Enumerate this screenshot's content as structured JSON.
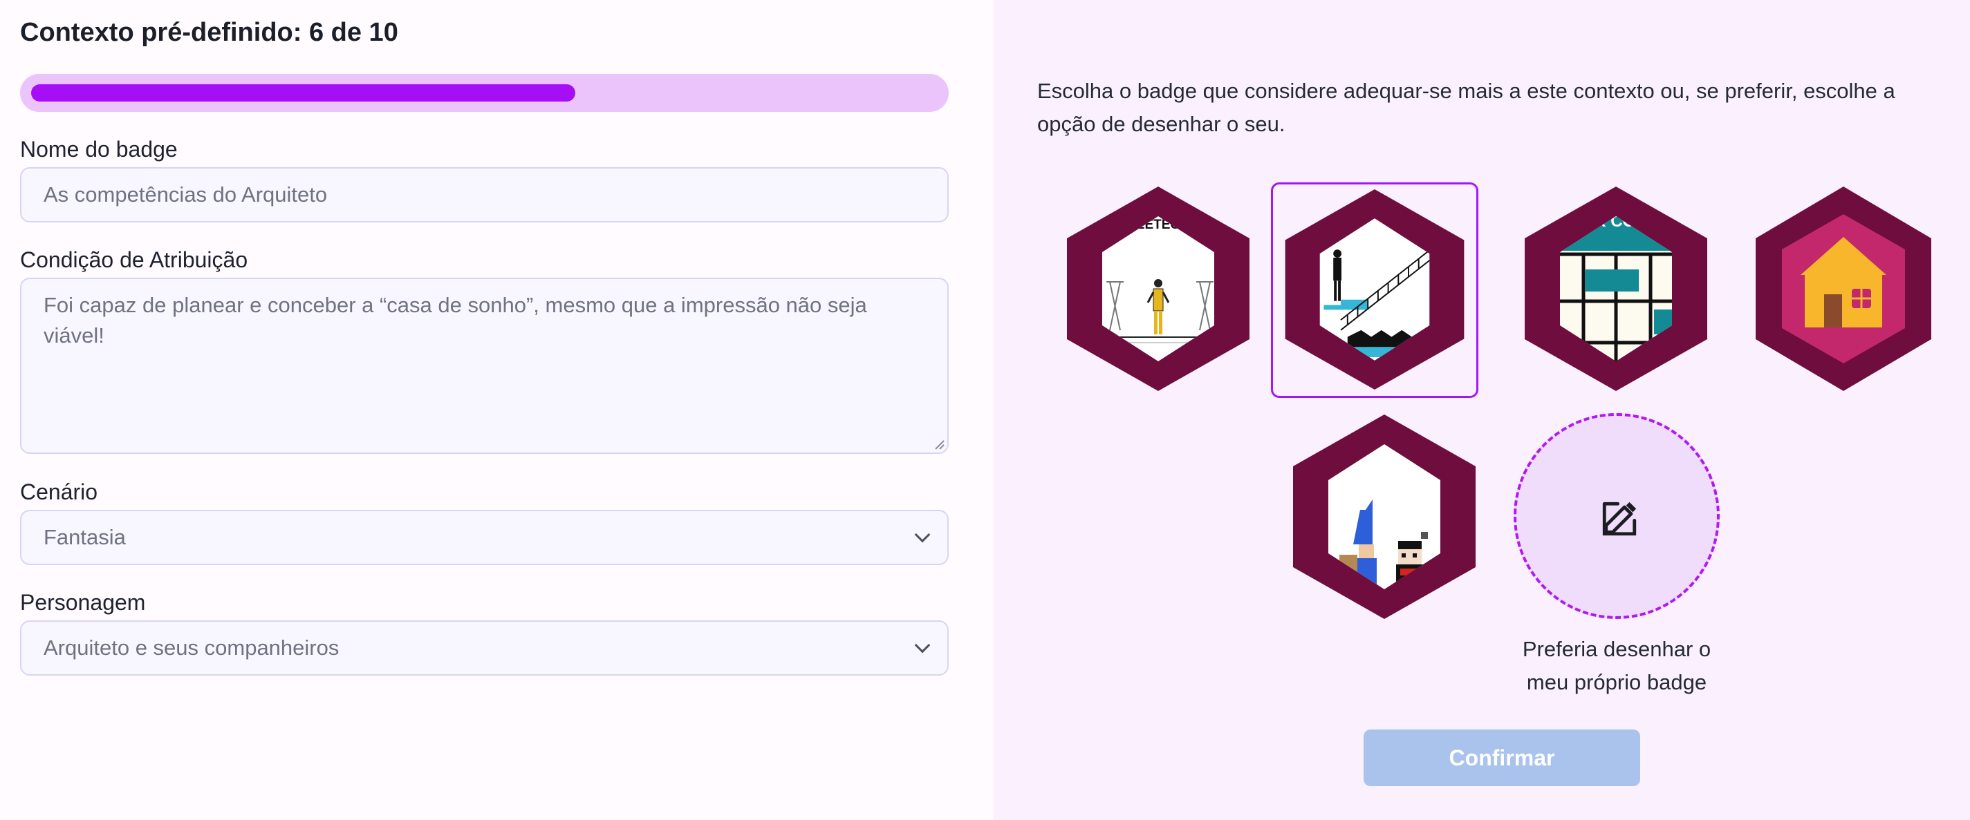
{
  "header": {
    "title": "Contexto pré-definido: 6 de 10"
  },
  "progress": {
    "current": 6,
    "total": 10,
    "fraction": 0.6
  },
  "form": {
    "badge_name_label": "Nome do badge",
    "badge_name_value": "As competências do Arquiteto",
    "condition_label": "Condição de Atribuição",
    "condition_value": "Foi capaz de planear e conceber a “casa de sonho”, mesmo que a impressão não seja viável!",
    "scenario_label": "Cenário",
    "scenario_value": "Fantasia",
    "character_label": "Personagem",
    "character_value": "Arquiteto e seus companheiros"
  },
  "picker": {
    "instructions": "Escolha o badge que considere adequar-se mais a este contexto ou, se preferir, escolhe a opção de desenhar o seu.",
    "badges": [
      {
        "id": "badge-1",
        "top_text": "CEETECO",
        "selected": false
      },
      {
        "id": "badge-2",
        "selected": true
      },
      {
        "id": "badge-3",
        "top_text": "ANTER COEMTO",
        "selected": false
      },
      {
        "id": "badge-4",
        "selected": false
      },
      {
        "id": "badge-5",
        "selected": false
      }
    ],
    "draw_own_label": "Preferia desenhar o meu próprio badge",
    "confirm_label": "Confirmar"
  },
  "colors": {
    "badge_frame": "#6e0d3e",
    "progress_fill": "#a60ef5",
    "progress_track": "#ebc4fc",
    "selected_border": "#a418f0",
    "confirm_bg": "#a9c3ec"
  }
}
